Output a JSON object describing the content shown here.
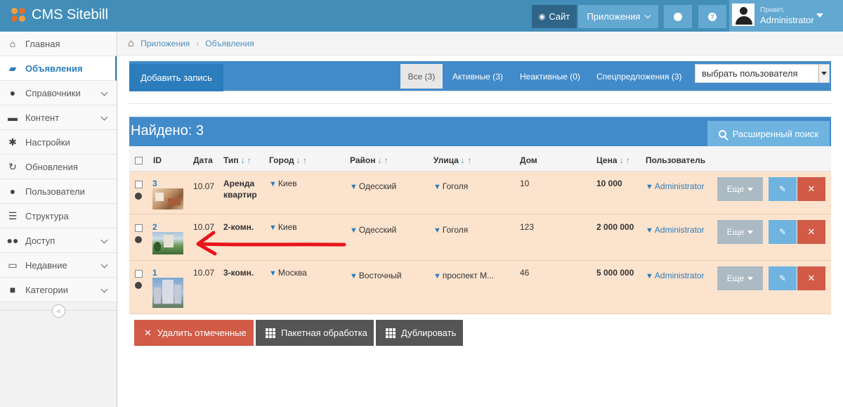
{
  "navbar": {
    "brand": "CMS Sitebill",
    "site_label": "Сайт",
    "apps_label": "Приложения",
    "user_greeting": "Привет,",
    "user_name": "Administrator"
  },
  "sidebar": {
    "items": [
      {
        "label": "Главная",
        "icon": "home-icon"
      },
      {
        "label": "Объявления",
        "icon": "book-icon",
        "active": true
      },
      {
        "label": "Справочники",
        "icon": "globe-icon",
        "has_submenu": true
      },
      {
        "label": "Контент",
        "icon": "coffee-icon",
        "has_submenu": true
      },
      {
        "label": "Настройки",
        "icon": "gear-icon"
      },
      {
        "label": "Обновления",
        "icon": "refresh-icon"
      },
      {
        "label": "Пользователи",
        "icon": "user-icon"
      },
      {
        "label": "Структура",
        "icon": "list-icon"
      },
      {
        "label": "Доступ",
        "icon": "users-icon",
        "has_submenu": true
      },
      {
        "label": "Недавние",
        "icon": "desktop-icon",
        "has_submenu": true
      },
      {
        "label": "Категории",
        "icon": "folder-icon",
        "has_submenu": true
      }
    ],
    "collapse_glyph": "«"
  },
  "breadcrumbs": {
    "items": [
      "Приложения",
      "Объявления"
    ],
    "separator": "›"
  },
  "toolbar": {
    "add_label": "Добавить запись",
    "tabs": [
      "Все (3)",
      "Активные (3)",
      "Неактивные (0)",
      "Спецпредложения (3)"
    ],
    "user_select_value": "выбрать пользователя"
  },
  "results": {
    "found_label": "Найдено: 3",
    "advanced_search_label": "Расширенный поиск"
  },
  "table": {
    "columns": {
      "id": "ID",
      "date": "Дата",
      "type": "Тип",
      "city": "Город",
      "district": "Район",
      "street": "Улица",
      "house": "Дом",
      "price": "Цена",
      "user": "Пользователь"
    },
    "sort_arrows": "↓ ↑",
    "more_label": "Еще",
    "rows": [
      {
        "id": "3",
        "date": "10.07",
        "type_line1": "Аренда",
        "type_line2": "квартир",
        "city": "Киев",
        "district": "Одесский",
        "street": "Гоголя",
        "house": "10",
        "price": "10 000",
        "user": "Administrator"
      },
      {
        "id": "2",
        "date": "10.07",
        "type_line1": "2-комн.",
        "type_line2": "",
        "city": "Киев",
        "district": "Одесский",
        "street": "Гоголя",
        "house": "123",
        "price": "2 000 000",
        "user": "Administrator"
      },
      {
        "id": "1",
        "date": "10.07",
        "type_line1": "3-комн.",
        "type_line2": "",
        "city": "Москва",
        "district": "Восточный",
        "street": "проспект М...",
        "house": "46",
        "price": "5 000 000",
        "user": "Administrator"
      }
    ]
  },
  "bottom_actions": {
    "delete_label": "Удалить отмеченные",
    "batch_label": "Пакетная обработка",
    "duplicate_label": "Дублировать"
  },
  "colors": {
    "navbar": "#438eb9",
    "row_highlight": "#fce3cd",
    "danger": "#d15b47",
    "annotation_arrow": "#e8141c"
  }
}
